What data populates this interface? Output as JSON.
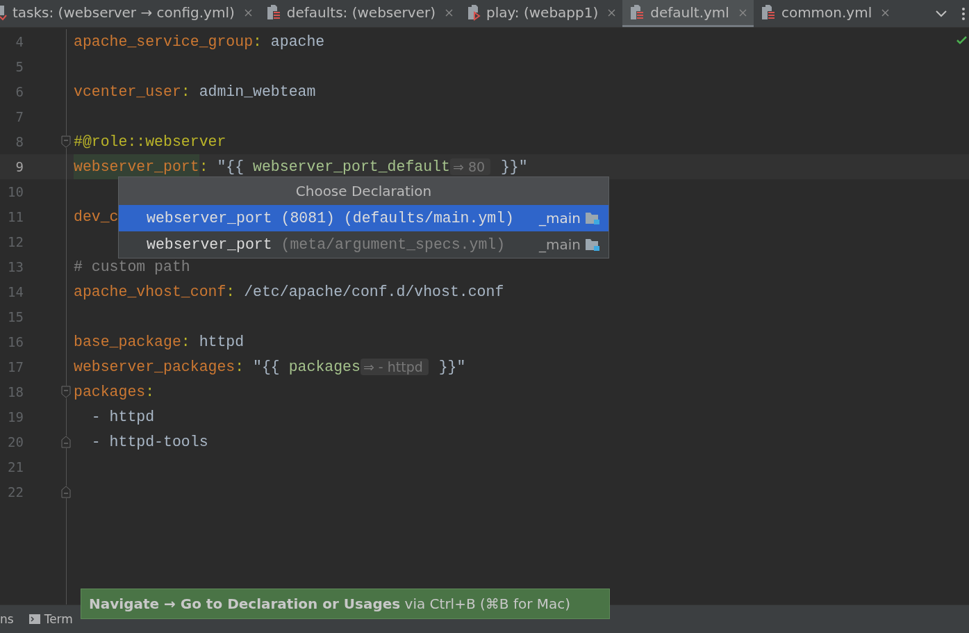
{
  "tabs": [
    {
      "label": "tasks: (webserver → config.yml)",
      "kind": "tasks",
      "selected": false
    },
    {
      "label": "defaults: (webserver)",
      "kind": "vars",
      "selected": false
    },
    {
      "label": "play: (webapp1)",
      "kind": "play",
      "selected": false
    },
    {
      "label": "default.yml",
      "kind": "vars",
      "selected": true
    },
    {
      "label": "common.yml",
      "kind": "vars",
      "selected": false
    }
  ],
  "editor": {
    "lines": [
      {
        "number": "4",
        "current": false,
        "kind": "plain",
        "tokens": [
          {
            "kind": "key",
            "text": "apache_service_group"
          },
          {
            "kind": "colon",
            "text": ": "
          },
          {
            "kind": "value",
            "text": "apache"
          }
        ]
      },
      {
        "number": "5",
        "current": false,
        "kind": "plain"
      },
      {
        "number": "6",
        "current": false,
        "kind": "plain",
        "tokens": [
          {
            "kind": "key",
            "text": "vcenter_user"
          },
          {
            "kind": "colon",
            "text": ": "
          },
          {
            "kind": "value",
            "text": "admin_webteam"
          }
        ]
      },
      {
        "number": "7",
        "current": false,
        "kind": "plain"
      },
      {
        "number": "8",
        "current": false,
        "kind": "fold_start",
        "tokens": [
          {
            "kind": "annotation",
            "text": "#@role::webserver"
          }
        ]
      },
      {
        "number": "9",
        "current": true,
        "kind": "plain",
        "tokens": [
          {
            "kind": "key_marked",
            "text": "webserver_port"
          },
          {
            "kind": "colon",
            "text": ": "
          },
          {
            "kind": "string",
            "text": "\"{{ "
          },
          {
            "kind": "var",
            "text": "webserver_port_default"
          },
          {
            "kind": "hint",
            "text": "⇒ 80"
          },
          {
            "kind": "string",
            "text": " }}\""
          }
        ]
      },
      {
        "number": "10",
        "current": false,
        "kind": "plain"
      },
      {
        "number": "11",
        "current": false,
        "kind": "plain",
        "tokens": [
          {
            "kind": "key",
            "text": "dev_c"
          }
        ]
      },
      {
        "number": "12",
        "current": false,
        "kind": "plain"
      },
      {
        "number": "13",
        "current": false,
        "kind": "plain",
        "tokens": [
          {
            "kind": "comment",
            "text": "# custom path"
          }
        ]
      },
      {
        "number": "14",
        "current": false,
        "kind": "plain",
        "tokens": [
          {
            "kind": "key",
            "text": "apache_vhost_conf"
          },
          {
            "kind": "colon",
            "text": ": "
          },
          {
            "kind": "value",
            "text": "/etc/apache/conf.d/vhost.conf"
          }
        ]
      },
      {
        "number": "15",
        "current": false,
        "kind": "plain"
      },
      {
        "number": "16",
        "current": false,
        "kind": "plain",
        "tokens": [
          {
            "kind": "key",
            "text": "base_package"
          },
          {
            "kind": "colon",
            "text": ": "
          },
          {
            "kind": "value",
            "text": "httpd"
          }
        ]
      },
      {
        "number": "17",
        "current": false,
        "kind": "plain",
        "tokens": [
          {
            "kind": "key",
            "text": "webserver_packages"
          },
          {
            "kind": "colon",
            "text": ": "
          },
          {
            "kind": "string",
            "text": "\"{{ "
          },
          {
            "kind": "var",
            "text": "packages"
          },
          {
            "kind": "hint",
            "text": "⇒ - httpd"
          },
          {
            "kind": "string",
            "text": " }}\""
          }
        ]
      },
      {
        "number": "18",
        "current": false,
        "kind": "fold_start",
        "tokens": [
          {
            "kind": "key",
            "text": "packages"
          },
          {
            "kind": "colon",
            "text": ":"
          }
        ]
      },
      {
        "number": "19",
        "current": false,
        "kind": "plain",
        "tokens": [
          {
            "kind": "value",
            "text": "  - httpd"
          }
        ]
      },
      {
        "number": "20",
        "current": false,
        "kind": "fold_end",
        "tokens": [
          {
            "kind": "value",
            "text": "  - httpd-tools"
          }
        ]
      },
      {
        "number": "21",
        "current": false,
        "kind": "plain"
      },
      {
        "number": "22",
        "current": false,
        "kind": "fold_end"
      }
    ]
  },
  "popup": {
    "title": "Choose Declaration",
    "items": [
      {
        "name": "webserver_port",
        "detail": "(8081) (defaults/main.yml)",
        "location": "_main",
        "selected": true
      },
      {
        "name": "webserver_port",
        "detail": "(meta/argument_specs.yml)",
        "location": "_main",
        "selected": false
      }
    ]
  },
  "bottom_bar": {
    "items": [
      {
        "label": "ns",
        "kind": "text"
      },
      {
        "label": "Term",
        "kind": "terminal"
      }
    ]
  },
  "tooltip": {
    "text": "**Navigate → Go to Declaration or Usages** via Ctrl+B (⌘B for Mac)"
  }
}
